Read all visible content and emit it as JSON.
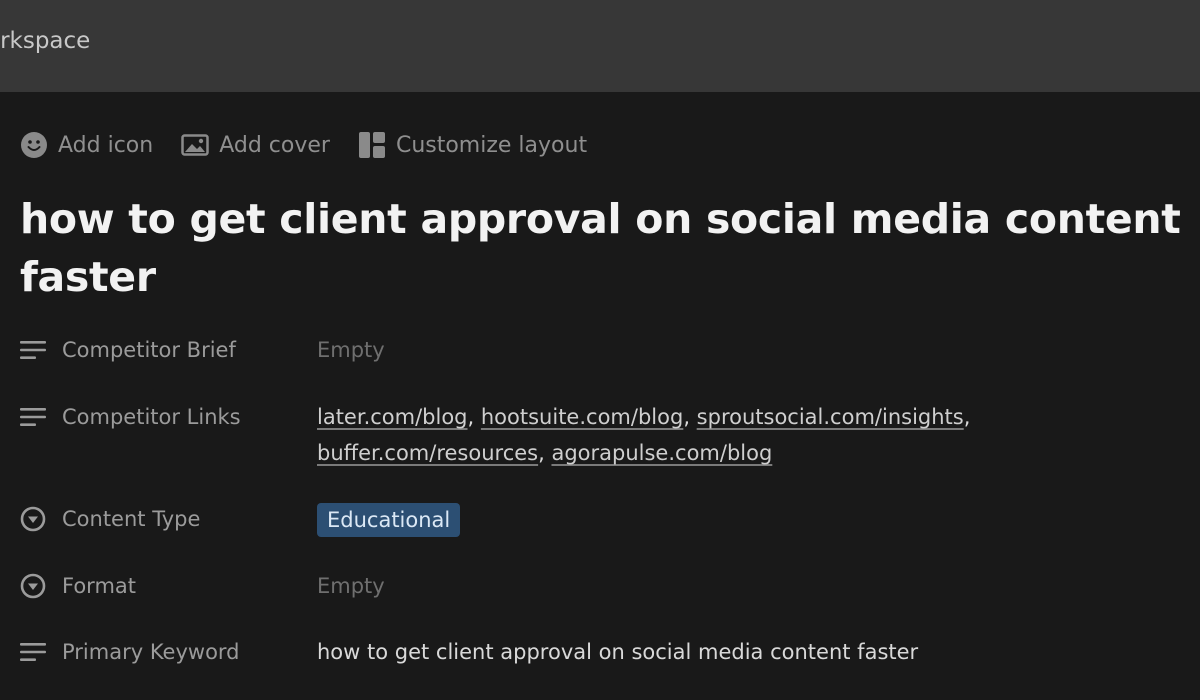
{
  "topbar": {
    "workspace_label": "orkspace"
  },
  "actions": {
    "add_icon": "Add icon",
    "add_cover": "Add cover",
    "customize_layout": "Customize layout"
  },
  "page": {
    "title": "how to get client approval on social media content faster"
  },
  "properties": {
    "competitor_brief": {
      "label": "Competitor Brief",
      "value": "Empty"
    },
    "competitor_links": {
      "label": "Competitor Links",
      "links": [
        "later.com/blog",
        "hootsuite.com/blog",
        "sproutsocial.com/insights",
        "buffer.com/resources",
        "agorapulse.com/blog"
      ]
    },
    "content_type": {
      "label": "Content Type",
      "value": "Educational",
      "tag_color": "#2c4f73"
    },
    "format": {
      "label": "Format",
      "value": "Empty"
    },
    "primary_keyword": {
      "label": "Primary Keyword",
      "value": "how to get client approval on social media content faster"
    }
  }
}
